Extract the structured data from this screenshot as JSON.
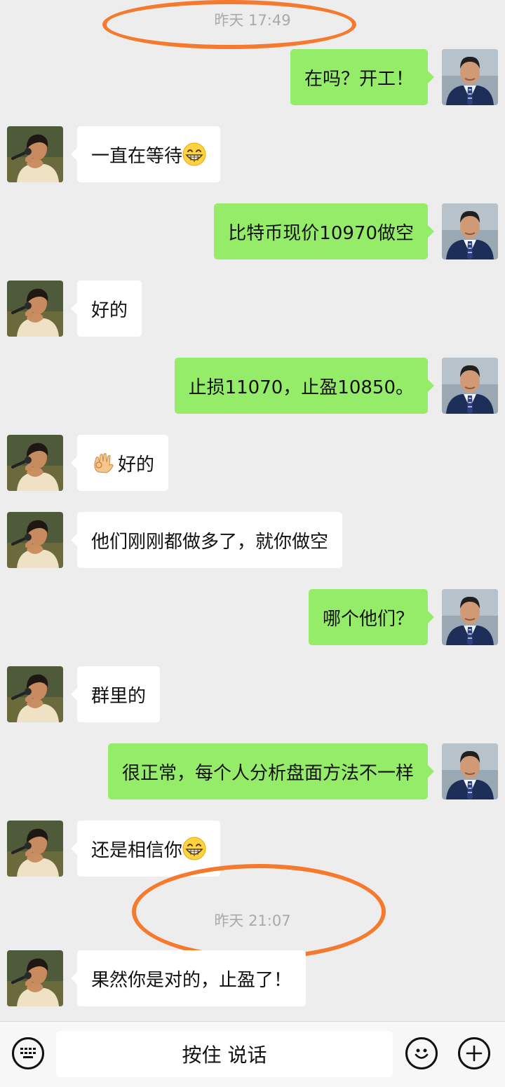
{
  "timestamps": [
    "昨天 17:49",
    "昨天 21:07"
  ],
  "messages": [
    {
      "side": "out",
      "text": "在吗？开工！"
    },
    {
      "side": "in",
      "text": "一直在等待",
      "emoji": "grin-emoji"
    },
    {
      "side": "out",
      "text": "比特币现价10970做空"
    },
    {
      "side": "in",
      "text": "好的"
    },
    {
      "side": "out",
      "text": "止损11070，止盈10850。"
    },
    {
      "side": "in",
      "text": "好的",
      "emoji_prefix": "ok-hand-emoji"
    },
    {
      "side": "in",
      "text": "他们刚刚都做多了，就你做空"
    },
    {
      "side": "out",
      "text": "哪个他们？"
    },
    {
      "side": "in",
      "text": "群里的"
    },
    {
      "side": "out",
      "text": "很正常，每个人分析盘面方法不一样"
    },
    {
      "side": "in",
      "text": "还是相信你",
      "emoji": "grin-emoji"
    },
    {
      "side": "in",
      "text": "果然你是对的，止盈了！"
    }
  ],
  "input_bar": {
    "talk_label": "按住 说话",
    "icons": [
      "keyboard-icon",
      "emoji-icon",
      "plus-icon"
    ]
  },
  "colors": {
    "background": "#ededed",
    "outgoing_bubble": "#95ec69",
    "incoming_bubble": "#ffffff",
    "annotation": "#f57a2e"
  }
}
